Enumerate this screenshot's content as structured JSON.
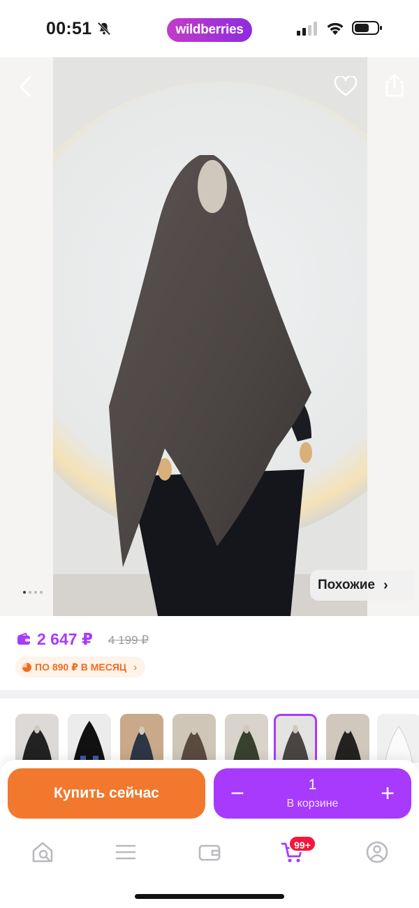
{
  "status_bar": {
    "time": "00:51",
    "brand": "wildberries"
  },
  "gallery": {
    "similar_label": "Похожие",
    "slide_count": 4,
    "active_slide": 1
  },
  "price": {
    "current": "2 647 ₽",
    "old": "4 199 ₽",
    "installment": "ПО 890 ₽ В МЕСЯЦ"
  },
  "variants": {
    "count": 8,
    "selected_index": 5
  },
  "actions": {
    "buy_now": "Купить сейчас",
    "quantity": "1",
    "in_cart": "В корзине",
    "minus": "−",
    "plus": "+"
  },
  "tab_bar": {
    "items": [
      "home-search",
      "catalog",
      "wallet",
      "cart",
      "profile"
    ],
    "cart_badge": "99+"
  },
  "colors": {
    "accent_purple": "#a73afd",
    "buy_orange": "#f1782c",
    "badge_red": "#f4163d",
    "installment_orange": "#f26b21"
  }
}
